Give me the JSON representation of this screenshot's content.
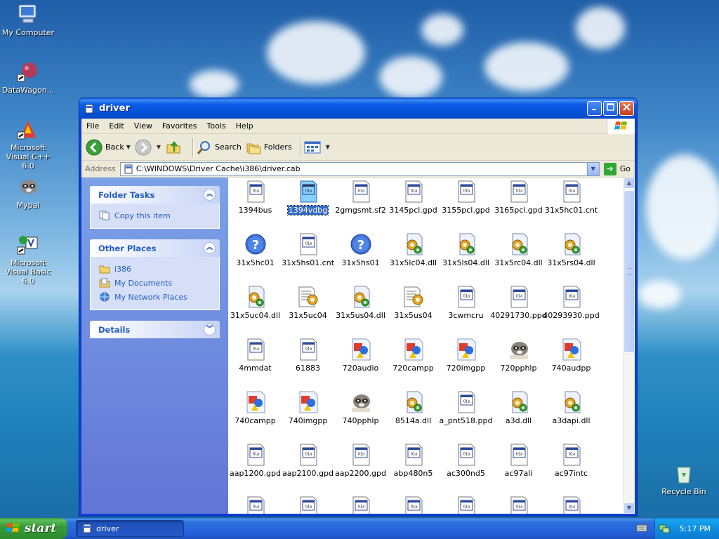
{
  "desktop": {
    "icons": [
      {
        "label": "My Computer"
      },
      {
        "label": "DataWagon..."
      },
      {
        "label": "Microsoft Visual C++ 6.0"
      },
      {
        "label": "Mypal"
      },
      {
        "label": "Microsoft Visual Basic 6.0"
      },
      {
        "label": "Recycle Bin"
      }
    ]
  },
  "window": {
    "title": "driver",
    "menu": [
      "File",
      "Edit",
      "View",
      "Favorites",
      "Tools",
      "Help"
    ],
    "toolbar": {
      "back": "Back",
      "search": "Search",
      "folders": "Folders"
    },
    "address": {
      "label": "Address",
      "value": "C:\\WINDOWS\\Driver Cache\\i386\\driver.cab",
      "go": "Go"
    }
  },
  "taskpane": {
    "folder_tasks": {
      "title": "Folder Tasks",
      "items": [
        "Copy this item"
      ]
    },
    "other_places": {
      "title": "Other Places",
      "items": [
        "i386",
        "My Documents",
        "My Network Places"
      ]
    },
    "details": {
      "title": "Details"
    }
  },
  "files": [
    {
      "name": "1394bus",
      "icon": "doc-window-icon"
    },
    {
      "name": "1394vdbg",
      "icon": "doc-window-icon",
      "selected": true
    },
    {
      "name": "2gmgsmt.sf2",
      "icon": "doc-window-icon"
    },
    {
      "name": "3145pcl.gpd",
      "icon": "doc-window-icon"
    },
    {
      "name": "3155pcl.gpd",
      "icon": "doc-window-icon"
    },
    {
      "name": "3165pcl.gpd",
      "icon": "doc-window-icon"
    },
    {
      "name": "31x5hc01.cnt",
      "icon": "doc-window-icon"
    },
    {
      "name": "31x5hc01",
      "icon": "help-icon"
    },
    {
      "name": "31x5hs01.cnt",
      "icon": "doc-window-icon"
    },
    {
      "name": "31x5hs01",
      "icon": "help-icon"
    },
    {
      "name": "31x5lc04.dll",
      "icon": "dll-gear-icon"
    },
    {
      "name": "31x5ls04.dll",
      "icon": "dll-gear-icon"
    },
    {
      "name": "31x5rc04.dll",
      "icon": "dll-gear-icon"
    },
    {
      "name": "31x5rs04.dll",
      "icon": "dll-gear-icon"
    },
    {
      "name": "31x5uc04.dll",
      "icon": "dll-gear-icon"
    },
    {
      "name": "31x5uc04",
      "icon": "config-icon"
    },
    {
      "name": "31x5us04.dll",
      "icon": "dll-gear-icon"
    },
    {
      "name": "31x5us04",
      "icon": "config-icon"
    },
    {
      "name": "3cwmcru",
      "icon": "doc-window-icon"
    },
    {
      "name": "40291730.ppd",
      "icon": "doc-window-icon"
    },
    {
      "name": "40293930.ppd",
      "icon": "doc-window-icon"
    },
    {
      "name": "4mmdat",
      "icon": "doc-window-icon"
    },
    {
      "name": "61883",
      "icon": "doc-window-icon"
    },
    {
      "name": "720audio",
      "icon": "color-shapes-icon"
    },
    {
      "name": "720campp",
      "icon": "color-shapes-icon"
    },
    {
      "name": "720imgpp",
      "icon": "color-shapes-icon"
    },
    {
      "name": "720pphlp",
      "icon": "raccoon-icon"
    },
    {
      "name": "740audpp",
      "icon": "color-shapes-icon"
    },
    {
      "name": "740campp",
      "icon": "color-shapes-icon"
    },
    {
      "name": "740imgpp",
      "icon": "color-shapes-icon"
    },
    {
      "name": "740pphlp",
      "icon": "raccoon-icon"
    },
    {
      "name": "8514a.dll",
      "icon": "dll-gear-icon"
    },
    {
      "name": "a_pnt518.ppd",
      "icon": "doc-window-icon"
    },
    {
      "name": "a3d.dll",
      "icon": "dll-gear-icon"
    },
    {
      "name": "a3dapi.dll",
      "icon": "dll-gear-icon"
    },
    {
      "name": "aap1200.gpd",
      "icon": "doc-window-icon"
    },
    {
      "name": "aap2100.gpd",
      "icon": "doc-window-icon"
    },
    {
      "name": "aap2200.gpd",
      "icon": "doc-window-icon"
    },
    {
      "name": "abp480n5",
      "icon": "doc-window-icon"
    },
    {
      "name": "ac300nd5",
      "icon": "doc-window-icon"
    },
    {
      "name": "ac97ali",
      "icon": "doc-window-icon"
    },
    {
      "name": "ac97intc",
      "icon": "doc-window-icon"
    },
    {
      "name": "",
      "icon": "doc-window-icon"
    },
    {
      "name": "",
      "icon": "doc-window-icon"
    },
    {
      "name": "",
      "icon": "doc-window-icon"
    },
    {
      "name": "",
      "icon": "doc-window-icon"
    },
    {
      "name": "",
      "icon": "doc-window-icon"
    },
    {
      "name": "",
      "icon": "doc-window-icon"
    },
    {
      "name": "",
      "icon": "doc-window-icon"
    }
  ],
  "taskbar": {
    "start_label": "start",
    "task_label": "driver",
    "clock": "5:17 PM"
  }
}
